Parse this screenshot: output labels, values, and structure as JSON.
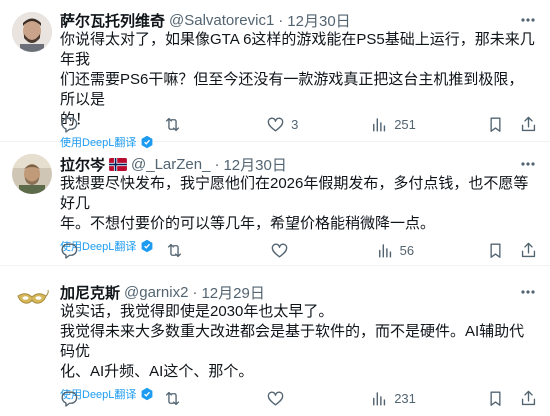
{
  "tweets": [
    {
      "name": "萨尔瓦托列维奇",
      "handle": "@Salvatorevic1",
      "dot": "·",
      "time": "12月30日",
      "lines": [
        "你说得太对了，如果像GTA 6这样的游戏能在PS5基础上运行，那未来几年我",
        "们还需要PS6干嘛？但至今还没有一款游戏真正把这台主机推到极限，所以是",
        "的！"
      ],
      "translate": "使用DeepL翻译",
      "replies": "",
      "retweets": "",
      "likes": "3",
      "views": "251"
    },
    {
      "name": "拉尔岑",
      "handle": "@_LarZen_",
      "dot": "·",
      "time": "12月30日",
      "lines": [
        "我想要尽快发布，我宁愿他们在2026年假期发布，多付点钱，也不愿等好几",
        "年。不想付要价的可以等几年，希望价格能稍微降一点。"
      ],
      "translate": "使用DeepL翻译",
      "replies": "",
      "retweets": "",
      "likes": "",
      "views": "56"
    },
    {
      "name": "加尼克斯",
      "handle": "@garnix2",
      "dot": "·",
      "time": "12月29日",
      "lines": [
        "说实话，我觉得即使是2030年也太早了。",
        "我觉得未来大多数重大改进都会是基于软件的，而不是硬件。AI辅助代码优",
        "化、AI升频、AI这个、那个。"
      ],
      "translate": "使用DeepL翻译",
      "replies": "",
      "retweets": "",
      "likes": "",
      "views": "231"
    }
  ],
  "colors": {
    "link": "#1d9bf0",
    "muted": "#536471",
    "text": "#0f1419",
    "divider": "#eff3f4"
  },
  "icons": {
    "reply": "reply-icon",
    "retweet": "retweet-icon",
    "like": "heart-icon",
    "views": "views-icon",
    "bookmark": "bookmark-icon",
    "share": "share-icon",
    "more": "more-icon",
    "translate": "translate-badge-icon",
    "flag": "norway-flag-icon"
  }
}
